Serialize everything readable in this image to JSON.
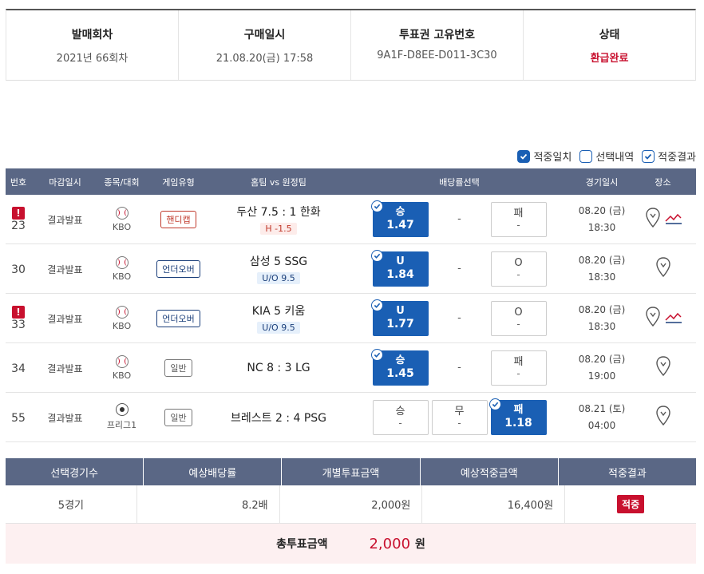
{
  "info": {
    "headers": [
      "발매회차",
      "구매일시",
      "투표권 고유번호",
      "상태"
    ],
    "values": [
      "2021년 66회차",
      "21.08.20(금) 17:58",
      "9A1F-D8EE-D011-3C30",
      "환급완료"
    ]
  },
  "legend": [
    "적중일치",
    "선택내역",
    "적중결과"
  ],
  "table_headers": [
    "번호",
    "마감일시",
    "종목/대회",
    "게임유형",
    "홈팀 vs 원정팀",
    "배당률선택",
    "경기일시",
    "장소"
  ],
  "rows": [
    {
      "no": "23",
      "warn": "!",
      "deadline": "결과발표",
      "league": "KBO",
      "type": "핸디캡",
      "match": "두산 7.5 : 1 한화",
      "sub": "H -1.5",
      "o1_label": "승",
      "o1_odd": "1.47",
      "o2_label": "-",
      "o3_label": "패",
      "o3_odd": "-",
      "date": "08.20 (금)",
      "time": "18:30"
    },
    {
      "no": "30",
      "deadline": "결과발표",
      "league": "KBO",
      "type": "언더오버",
      "match": "삼성 5 SSG",
      "sub": "U/O 9.5",
      "o1_label": "U",
      "o1_odd": "1.84",
      "o2_label": "-",
      "o3_label": "O",
      "o3_odd": "-",
      "date": "08.20 (금)",
      "time": "18:30"
    },
    {
      "no": "33",
      "warn": "!",
      "deadline": "결과발표",
      "league": "KBO",
      "type": "언더오버",
      "match": "KIA 5 키움",
      "sub": "U/O 9.5",
      "o1_label": "U",
      "o1_odd": "1.77",
      "o2_label": "-",
      "o3_label": "O",
      "o3_odd": "-",
      "date": "08.20 (금)",
      "time": "18:30"
    },
    {
      "no": "34",
      "deadline": "결과발표",
      "league": "KBO",
      "type": "일반",
      "match": "NC 8 : 3 LG",
      "o1_label": "승",
      "o1_odd": "1.45",
      "o2_label": "-",
      "o3_label": "패",
      "o3_odd": "-",
      "date": "08.20 (금)",
      "time": "19:00"
    },
    {
      "no": "55",
      "deadline": "결과발표",
      "league": "프리그1",
      "type": "일반",
      "match": "브레스트 2 : 4 PSG",
      "o1_label": "승",
      "o1_odd": "-",
      "o2_label": "무",
      "o2_odd": "-",
      "o3_label": "패",
      "o3_odd": "1.18",
      "date": "08.21 (토)",
      "time": "04:00"
    }
  ],
  "summary": {
    "headers": [
      "선택경기수",
      "예상배당률",
      "개별투표금액",
      "예상적중금액",
      "적중결과"
    ],
    "values": [
      "5경기",
      "8.2배",
      "2,000원",
      "16,400원",
      "적중"
    ]
  },
  "total": {
    "label": "총투표금액",
    "amount": "2,000",
    "unit": "원"
  }
}
